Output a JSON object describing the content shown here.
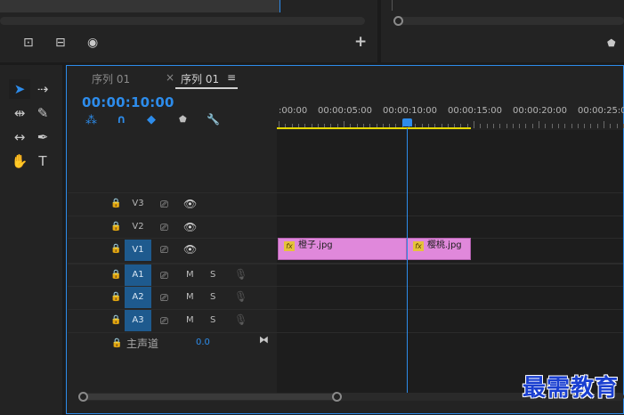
{
  "source_monitor": {
    "controls": [
      {
        "name": "insert-icon",
        "glyph": "⊡"
      },
      {
        "name": "overwrite-icon",
        "glyph": "⊟"
      },
      {
        "name": "camera-icon",
        "glyph": "◉"
      }
    ],
    "add_glyph": "+"
  },
  "program_monitor": {
    "marker_glyph": "⬟"
  },
  "tools": [
    {
      "name": "selection-tool-icon",
      "glyph": "➤",
      "active": true
    },
    {
      "name": "track-select-tool-icon",
      "glyph": "⇢",
      "active": false
    },
    {
      "name": "ripple-edit-tool-icon",
      "glyph": "⇹",
      "active": false
    },
    {
      "name": "razor-tool-icon",
      "glyph": "✎",
      "active": false
    },
    {
      "name": "slip-tool-icon",
      "glyph": "↔",
      "active": false
    },
    {
      "name": "pen-tool-icon",
      "glyph": "✒",
      "active": false
    },
    {
      "name": "hand-tool-icon",
      "glyph": "✋",
      "active": false
    },
    {
      "name": "type-tool-icon",
      "glyph": "T",
      "active": false
    }
  ],
  "timeline": {
    "tabs": [
      {
        "label": "序列 01",
        "close": "×",
        "active": false
      },
      {
        "label": "序列 01",
        "menu": "≡",
        "active": true
      }
    ],
    "timecode": "00:00:10:00",
    "header_icons": [
      {
        "name": "snap-icon",
        "glyph": "⁂",
        "color": "blue"
      },
      {
        "name": "linked-selection-icon",
        "glyph": "∩",
        "color": "blue"
      },
      {
        "name": "add-marker-icon",
        "glyph": "◆",
        "color": "blue"
      },
      {
        "name": "marker-icon",
        "glyph": "⬟",
        "color": "grey"
      },
      {
        "name": "wrench-icon",
        "glyph": "🔧",
        "color": "grey"
      }
    ],
    "ruler_labels": [
      ":00:00",
      "00:00:05:00",
      "00:00:10:00",
      "00:00:15:00",
      "00:00:20:00",
      "00:00:25:0"
    ],
    "video_tracks": [
      {
        "name": "V3",
        "targeted": false
      },
      {
        "name": "V2",
        "targeted": false
      },
      {
        "name": "V1",
        "targeted": true
      }
    ],
    "audio_tracks": [
      {
        "name": "A1",
        "m": "M",
        "s": "S"
      },
      {
        "name": "A2",
        "m": "M",
        "s": "S"
      },
      {
        "name": "A3",
        "m": "M",
        "s": "S"
      }
    ],
    "master_track": {
      "label": "主声道",
      "value": "0.0",
      "icon": "⧓"
    },
    "clips": [
      {
        "fx": "fx",
        "name": "橙子.jpg"
      },
      {
        "fx": "fx",
        "name": "樱桃.jpg"
      }
    ],
    "lock_glyph": "🔒",
    "film_glyph": "⎚",
    "eye_glyph": "👁",
    "mic_glyph": "🎙"
  },
  "watermark": "最需教育",
  "colors": {
    "accent": "#2d8ceb",
    "clip": "#e088db",
    "work_area": "#e5d800",
    "track_target": "#1e5a8e"
  }
}
